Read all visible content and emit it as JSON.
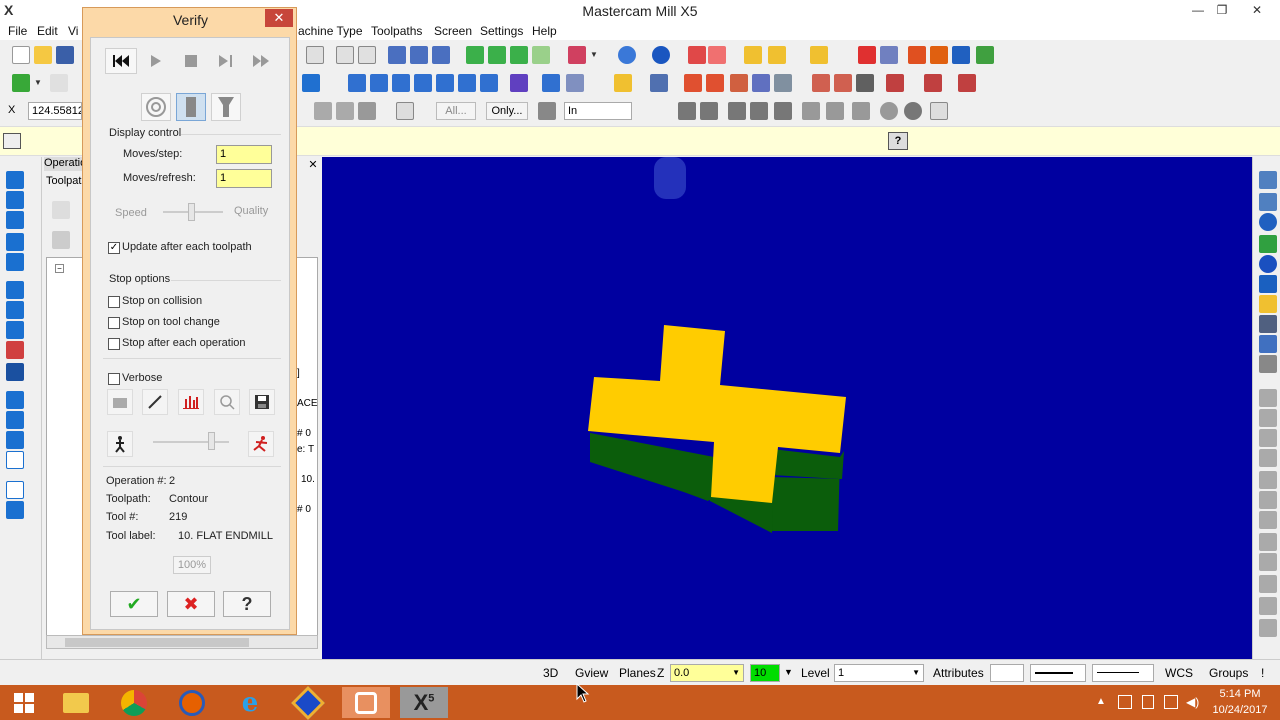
{
  "app": {
    "title": "Mastercam Mill X5",
    "logo": "X",
    "minimize": "—",
    "maximize": "❐",
    "close": "✕"
  },
  "menu": [
    "File",
    "Edit",
    "Vi",
    "achine Type",
    "Toolpaths",
    "Screen",
    "Settings",
    "Help"
  ],
  "coord_input": "124.55812",
  "toolbar3": {
    "all_label": "All...",
    "only_label": "Only...",
    "in_select": "In"
  },
  "ops_panel": {
    "tab_ops": "Operatio",
    "tab_toolpaths": "Toolpat",
    "close": "✕",
    "frag1": "]",
    "frag2": "ACE",
    "frag3": "# 0",
    "frag4": "e: T",
    "frag5": "10.",
    "frag6": "# 0"
  },
  "verify": {
    "title": "Verify",
    "close": "✕",
    "display_control": "Display control",
    "moves_step_label": "Moves/step:",
    "moves_step_value": "1",
    "moves_refresh_label": "Moves/refresh:",
    "moves_refresh_value": "1",
    "speed_label": "Speed",
    "quality_label": "Quality",
    "update_label": "Update after each toolpath",
    "update_checked": true,
    "stop_options": "Stop options",
    "stop_collision": "Stop on collision",
    "stop_tool_change": "Stop on tool change",
    "stop_each_op": "Stop after each operation",
    "verbose": "Verbose",
    "info": {
      "operation_label": "Operation #:",
      "operation_value": "2",
      "toolpath_label": "Toolpath:",
      "toolpath_value": "Contour",
      "tool_label": "Tool #:",
      "tool_value": "219",
      "toollabel_label": "Tool label:",
      "toollabel_value": "10. FLAT ENDMILL"
    },
    "progress": "100%",
    "ok": "✔",
    "cancel": "✖",
    "help": "?"
  },
  "statusbar": {
    "view3d": "3D",
    "gview": "Gview",
    "planes": "Planes",
    "z_label": "Z",
    "z_value": "0.0",
    "color_value": "10",
    "level_label": "Level",
    "level_value": "1",
    "attributes": "Attributes",
    "wcs": "WCS",
    "groups": "Groups",
    "bang": "!"
  },
  "taskbar": {
    "time": "5:14 PM",
    "date": "10/24/2017"
  },
  "colors": {
    "viewport": "#0000a0",
    "part_top": "#ffcc00",
    "part_side": "#0b5d0b",
    "dialog_frame": "#fcd9a8",
    "taskbar": "#c85a1e"
  }
}
